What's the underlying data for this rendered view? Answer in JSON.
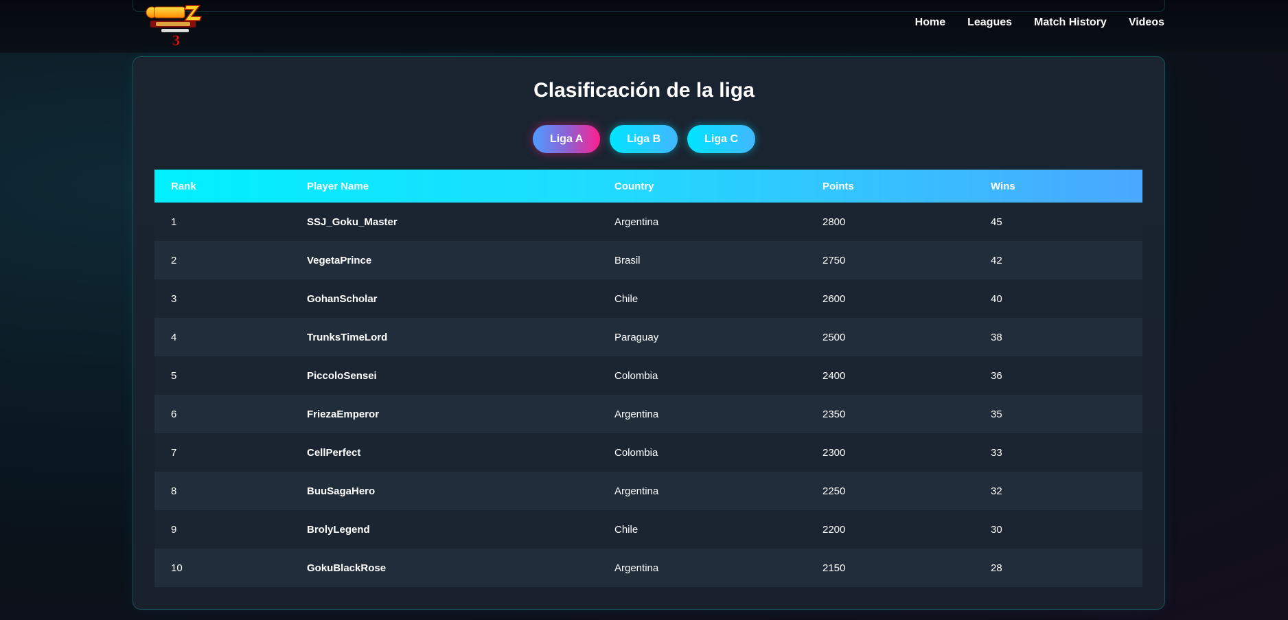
{
  "nav": {
    "logo_alt": "Dragon Ball Z Budokai Tenkaichi 3",
    "items": [
      "Home",
      "Leagues",
      "Match History",
      "Videos"
    ]
  },
  "page": {
    "title": "Clasificación de la liga"
  },
  "tabs": [
    {
      "label": "Liga A",
      "active": true
    },
    {
      "label": "Liga B",
      "active": false
    },
    {
      "label": "Liga C",
      "active": false
    }
  ],
  "table": {
    "columns": [
      "Rank",
      "Player Name",
      "Country",
      "Points",
      "Wins"
    ],
    "rows": [
      {
        "rank": "1",
        "name": "SSJ_Goku_Master",
        "country": "Argentina",
        "points": "2800",
        "wins": "45"
      },
      {
        "rank": "2",
        "name": "VegetaPrince",
        "country": "Brasil",
        "points": "2750",
        "wins": "42"
      },
      {
        "rank": "3",
        "name": "GohanScholar",
        "country": "Chile",
        "points": "2600",
        "wins": "40"
      },
      {
        "rank": "4",
        "name": "TrunksTimeLord",
        "country": "Paraguay",
        "points": "2500",
        "wins": "38"
      },
      {
        "rank": "5",
        "name": "PiccoloSensei",
        "country": "Colombia",
        "points": "2400",
        "wins": "36"
      },
      {
        "rank": "6",
        "name": "FriezaEmperor",
        "country": "Argentina",
        "points": "2350",
        "wins": "35"
      },
      {
        "rank": "7",
        "name": "CellPerfect",
        "country": "Colombia",
        "points": "2300",
        "wins": "33"
      },
      {
        "rank": "8",
        "name": "BuuSagaHero",
        "country": "Argentina",
        "points": "2250",
        "wins": "32"
      },
      {
        "rank": "9",
        "name": "BrolyLegend",
        "country": "Chile",
        "points": "2200",
        "wins": "30"
      },
      {
        "rank": "10",
        "name": "GokuBlackRose",
        "country": "Argentina",
        "points": "2150",
        "wins": "28"
      }
    ]
  },
  "colors": {
    "accent_cyan": "#00e5ff",
    "accent_pink": "#ff1f8f",
    "accent_blue": "#4aa8ff"
  }
}
